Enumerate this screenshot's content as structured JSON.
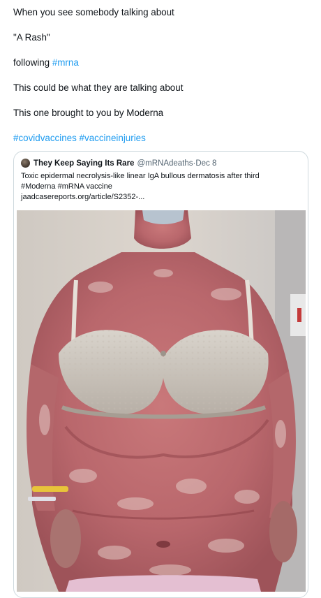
{
  "post": {
    "line1": "When you see somebody talking about",
    "line2": "\"A Rash\"",
    "line3_prefix": "following ",
    "line3_hashtag": "#mrna",
    "line4": "This could be what they are talking about",
    "line5": "This one brought to you by Moderna",
    "hashtags": [
      "#covidvaccines",
      "#vaccineinjuries"
    ]
  },
  "quote": {
    "author_name": "They Keep Saying Its Rare",
    "author_handle": "@mRNAdeaths",
    "separator": " · ",
    "date": "Dec 8",
    "text_line1": "Toxic epidermal necrolysis-like linear IgA bullous dermatosis after third",
    "text_line2_hashtag": "#Moderna",
    "text_line2_rest": " #mRNA vaccine",
    "link": "jaadcasereports.org/article/S2352-..."
  },
  "colors": {
    "link": "#1d9bf0",
    "text": "#0f1419",
    "muted": "#536471",
    "border": "#cfd9de"
  }
}
